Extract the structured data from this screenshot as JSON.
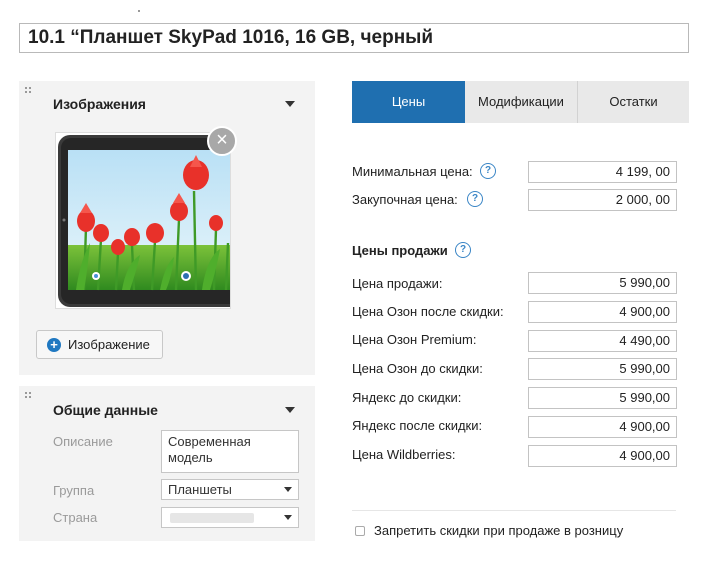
{
  "product": {
    "title": "10.1 “Планшет SkyPad 1016, 16 GB, черный"
  },
  "images_panel": {
    "title": "Изображения",
    "add_image_label": "Изображение",
    "image_alt": "Планшет с изображением тюльпанов"
  },
  "general_panel": {
    "title": "Общие данные",
    "fields": {
      "description": {
        "label": "Описание",
        "value_line1": "Современная",
        "value_line2": "модель"
      },
      "group": {
        "label": "Группа",
        "value": "Планшеты"
      },
      "country": {
        "label": "Страна",
        "value": ""
      }
    }
  },
  "tabs": [
    {
      "label": "Цены",
      "active": true
    },
    {
      "label": "Модификации",
      "active": false
    },
    {
      "label": "Остатки",
      "active": false
    }
  ],
  "prices": {
    "min_price": {
      "label": "Минимальная цена:",
      "value": "4 199, 00"
    },
    "purchase_price": {
      "label": "Закупочная цена:",
      "value": "2 000, 00"
    },
    "sale_section_title": "Цены продажи",
    "sale_prices": [
      {
        "label": "Цена продажи:",
        "value": "5 990,00"
      },
      {
        "label": "Цена Озон после скидки:",
        "value": "4 900,00"
      },
      {
        "label": "Цена Озон Premium:",
        "value": "4 490,00"
      },
      {
        "label": "Цена Озон до скидки:",
        "value": "5 990,00"
      },
      {
        "label": "Яндекс до скидки:",
        "value": "5 990,00"
      },
      {
        "label": "Яндекс после скидки:",
        "value": "4 900,00"
      },
      {
        "label": "Цена Wildberries:",
        "value": "4 900,00"
      }
    ]
  },
  "retail_discount": {
    "label": "Запретить скидки при продаже в розницу",
    "checked": false
  },
  "colors": {
    "accent": "#1f6fb0",
    "help_icon": "#3b86c6"
  },
  "icons": {
    "close": "close-icon",
    "add": "plus-circle-icon",
    "collapse": "caret-down-icon",
    "drag": "drag-handle-icon",
    "help": "help-icon"
  }
}
